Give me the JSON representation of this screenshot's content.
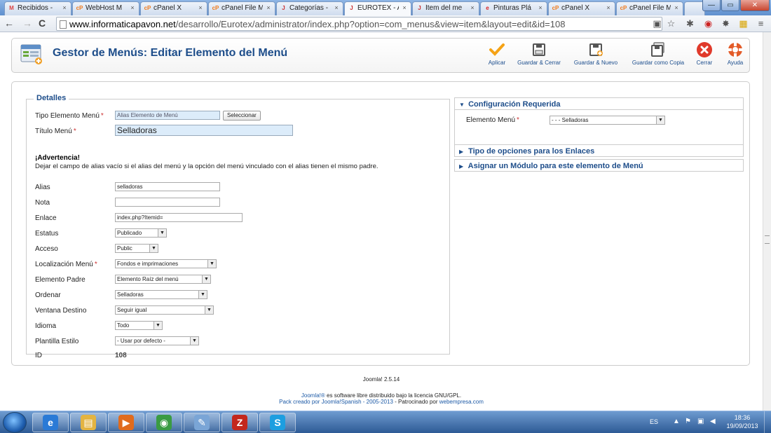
{
  "browser": {
    "tabs": [
      {
        "icon": "gmail-icon",
        "label": "Recibidos - ",
        "active": false
      },
      {
        "icon": "cpanel-icon",
        "label": "WebHost M",
        "active": false
      },
      {
        "icon": "cpanel-icon",
        "label": "cPanel X",
        "active": false
      },
      {
        "icon": "cpanel-icon",
        "label": "cPanel File M",
        "active": false
      },
      {
        "icon": "joomla-icon",
        "label": "Categorías - ",
        "active": false
      },
      {
        "icon": "joomla-icon",
        "label": "EUROTEX - A",
        "active": true
      },
      {
        "icon": "joomla-icon",
        "label": "Ítem del me",
        "active": false
      },
      {
        "icon": "pinturas-icon",
        "label": "Pinturas Plá",
        "active": false
      },
      {
        "icon": "cpanel-icon",
        "label": "cPanel X",
        "active": false
      },
      {
        "icon": "cpanel-icon",
        "label": "cPanel File M",
        "active": false
      }
    ],
    "tab_close": "×",
    "window_buttons": {
      "minimize": "—",
      "maximize": "▭",
      "close": "✕"
    },
    "nav": {
      "back": "←",
      "forward": "→",
      "reload": "C"
    },
    "url": {
      "host": "www.informaticapavon.net",
      "path": "/desarrollo/Eurotex/administrator/index.php?option=com_menus&view=item&layout=edit&id=108"
    },
    "address_icons": {
      "star": "☆",
      "wrench": "✱",
      "addon1": "◉",
      "addon2": "✸",
      "menu": "≡"
    }
  },
  "toolbar": {
    "title": "Gestor de Menús: Editar Elemento del Menú",
    "buttons": [
      {
        "name": "apply",
        "label": "Aplicar",
        "icon": "check-icon"
      },
      {
        "name": "save-close",
        "label": "Guardar & Cerrar",
        "icon": "save-icon"
      },
      {
        "name": "save-new",
        "label": "Guardar & Nuevo",
        "icon": "save-new-icon"
      },
      {
        "name": "save-copy",
        "label": "Guardar como Copia",
        "icon": "save-copy-icon"
      },
      {
        "name": "close",
        "label": "Cerrar",
        "icon": "close-icon"
      },
      {
        "name": "help",
        "label": "Ayuda",
        "icon": "help-icon"
      }
    ],
    "colors": {
      "title": "#1d4d8a",
      "check": "#f5a316",
      "close": "#e03a2b",
      "help": "#e35b28"
    }
  },
  "form": {
    "legend": "Detalles",
    "required_marker": "*",
    "fields": {
      "type": {
        "label": "Tipo Elemento Menú",
        "value": "Alias Elemento de Menú",
        "button": "Seleccionar"
      },
      "title": {
        "label": "Título Menú",
        "value": "Selladoras"
      },
      "alias": {
        "label": "Alias",
        "value": "selladoras"
      },
      "note": {
        "label": "Nota",
        "value": ""
      },
      "link": {
        "label": "Enlace",
        "value": "index.php?Itemid="
      },
      "status": {
        "label": "Estatus",
        "value": "Publicado"
      },
      "access": {
        "label": "Acceso",
        "value": "Public"
      },
      "menu_location": {
        "label": "Localización Menú",
        "value": "Fondos e imprimaciones"
      },
      "parent": {
        "label": "Elemento Padre",
        "value": "Elemento Raíz del menú"
      },
      "ordering": {
        "label": "Ordenar",
        "value": "Selladoras"
      },
      "target": {
        "label": "Ventana Destino",
        "value": "Seguir igual"
      },
      "language": {
        "label": "Idioma",
        "value": "Todo"
      },
      "template": {
        "label": "Plantilla Estilo",
        "value": "- Usar por defecto -"
      },
      "id": {
        "label": "ID",
        "value": "108"
      }
    },
    "warning": {
      "title": "¡Advertencia!",
      "text": "Dejar el campo de alias vacío si el alias del menú y la opción del menú vinculado con el alias tienen el mismo padre."
    }
  },
  "right_panel": {
    "sections": [
      {
        "label": "Configuración Requerida",
        "expanded": true
      },
      {
        "label": "Tipo de opciones para los Enlaces",
        "expanded": false
      },
      {
        "label": "Asignar un Módulo para este elemento de Menú",
        "expanded": false
      }
    ],
    "required_field": {
      "label": "Elemento Menú",
      "value": "- - - Selladoras"
    },
    "expanded_marker": "▼",
    "collapsed_marker": "▶"
  },
  "footer": {
    "version": "Joomla! 2.5.14",
    "license_link": "Joomla!®",
    "license_text": " es software libre distribuido bajo la licencia GNU/GPL.",
    "pack_link": "Pack creado por Joomla!Spanish - 2005-2013",
    "sponsor_text": " - Patrocinado por ",
    "sponsor_link": "webempresa.com"
  },
  "taskbar": {
    "apps": [
      {
        "icon": "ie-icon",
        "glyph": "e",
        "color": "#2a7ad6"
      },
      {
        "icon": "explorer-icon",
        "glyph": "▤",
        "color": "#e3b442"
      },
      {
        "icon": "media-player-icon",
        "glyph": "▶",
        "color": "#e06b1d"
      },
      {
        "icon": "chrome-icon",
        "glyph": "◉",
        "color": "#3a9b43"
      },
      {
        "icon": "paint-icon",
        "glyph": "✎",
        "color": "#7aa5d6"
      },
      {
        "icon": "filezilla-icon",
        "glyph": "Z",
        "color": "#c3271d"
      },
      {
        "icon": "skype-icon",
        "glyph": "S",
        "color": "#1d9ee0"
      }
    ],
    "language": "ES",
    "time": "18:36",
    "date": "19/09/2013",
    "tray_up": "▲",
    "tray_flag": "⚑",
    "tray_network": "▣",
    "tray_volume": "◀"
  }
}
